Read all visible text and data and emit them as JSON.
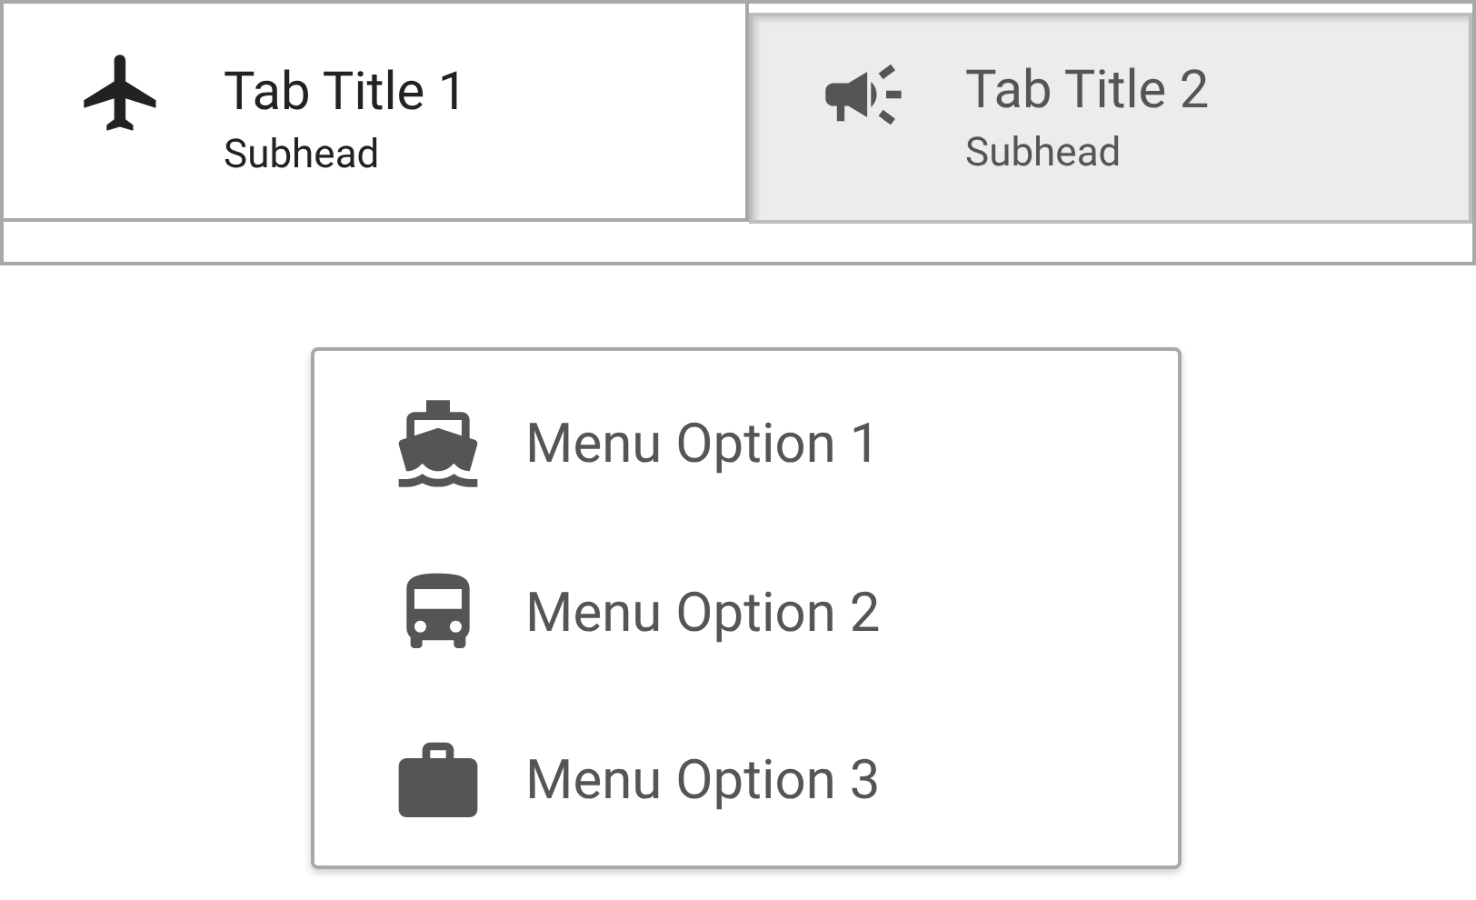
{
  "tabs": [
    {
      "title": "Tab Title 1",
      "subhead": "Subhead",
      "selected": true
    },
    {
      "title": "Tab Title 2",
      "subhead": "Subhead",
      "selected": false
    }
  ],
  "menu": {
    "items": [
      {
        "label": "Menu Option 1"
      },
      {
        "label": "Menu Option 2"
      },
      {
        "label": "Menu Option 3"
      }
    ]
  }
}
